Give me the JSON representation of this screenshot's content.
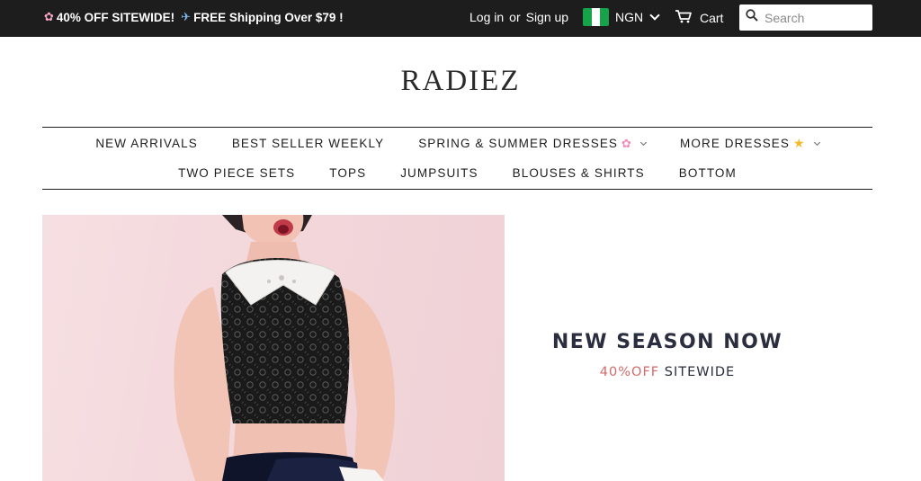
{
  "colors": {
    "topbar_bg": "#1d1d1d",
    "text": "#1c1d1d",
    "hero_heading": "#2a2e3f",
    "promo_accent": "#d46a6a",
    "hero_bg_pink": "#f2d6da"
  },
  "announcement": {
    "icon_left": "cherry-blossom-icon",
    "part1": "40% OFF SITEWIDE!",
    "icon_mid": "airplane-icon",
    "part2": "FREE Shipping Over $79 !"
  },
  "account": {
    "login": "Log in",
    "separator": "or",
    "signup": "Sign up"
  },
  "currency": {
    "flag": "nigeria-flag-icon",
    "selected": "NGN"
  },
  "cart": {
    "icon": "cart-icon",
    "label": "Cart"
  },
  "search": {
    "icon": "search-icon",
    "placeholder": "Search",
    "value": ""
  },
  "logo": {
    "text": "RADIEZ"
  },
  "nav": {
    "row1": [
      {
        "label": "NEW ARRIVALS"
      },
      {
        "label": "BEST SELLER WEEKLY"
      },
      {
        "label": "SPRING & SUMMER DRESSES",
        "icon": "cherry-blossom-icon",
        "dropdown": true
      },
      {
        "label": "MORE DRESSES",
        "icon": "star-icon",
        "dropdown": true
      }
    ],
    "row2": [
      {
        "label": "TWO PIECE SETS"
      },
      {
        "label": "TOPS"
      },
      {
        "label": "JUMPSUITS"
      },
      {
        "label": "BLOUSES & SHIRTS"
      },
      {
        "label": "BOTTOM"
      }
    ]
  },
  "hero": {
    "image": "model-lace-top-photo",
    "title": "NEW SEASON NOW",
    "sub_accent": "40%OFF",
    "sub_rest": " SITEWIDE"
  }
}
